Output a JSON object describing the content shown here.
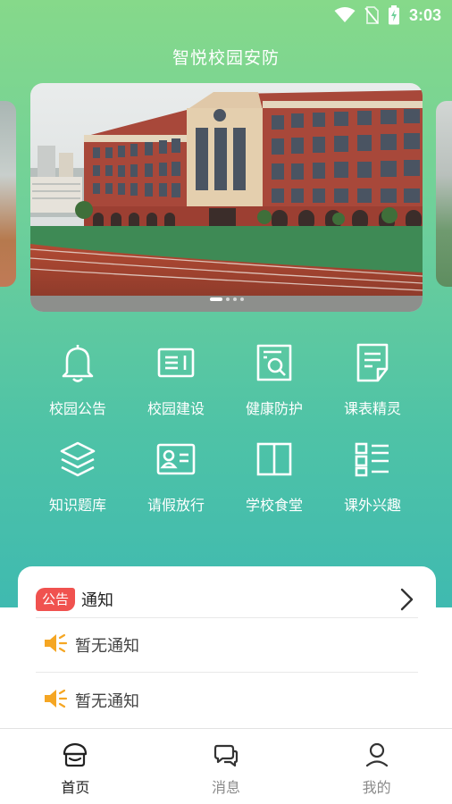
{
  "status_bar": {
    "time": "3:03",
    "icons": [
      "wifi-icon",
      "no-sim-icon",
      "battery-charging-icon"
    ]
  },
  "app_title": "智悦校园安防",
  "carousel": {
    "slide_count": 4,
    "active_index": 0,
    "image": "school-building-photo"
  },
  "grid": [
    {
      "label": "校园公告",
      "icon": "bell-icon"
    },
    {
      "label": "校园建设",
      "icon": "newspaper-icon"
    },
    {
      "label": "健康防护",
      "icon": "document-search-icon"
    },
    {
      "label": "课表精灵",
      "icon": "note-icon"
    },
    {
      "label": "知识题库",
      "icon": "layers-icon"
    },
    {
      "label": "请假放行",
      "icon": "id-card-icon"
    },
    {
      "label": "学校食堂",
      "icon": "book-open-icon"
    },
    {
      "label": "课外兴趣",
      "icon": "list-icon"
    }
  ],
  "notice": {
    "badge": "公告",
    "title": "通知",
    "items": [
      {
        "text": "暂无通知",
        "icon": "speaker-icon"
      },
      {
        "text": "暂无通知",
        "icon": "speaker-icon"
      }
    ]
  },
  "bottom_nav": [
    {
      "label": "首页",
      "icon": "home-icon",
      "active": true
    },
    {
      "label": "消息",
      "icon": "chat-icon",
      "active": false
    },
    {
      "label": "我的",
      "icon": "user-icon",
      "active": false
    }
  ],
  "colors": {
    "gradient_top": "#86d98a",
    "gradient_bottom": "#3fbab0",
    "badge": "#f0524f",
    "speaker": "#f5a623"
  }
}
